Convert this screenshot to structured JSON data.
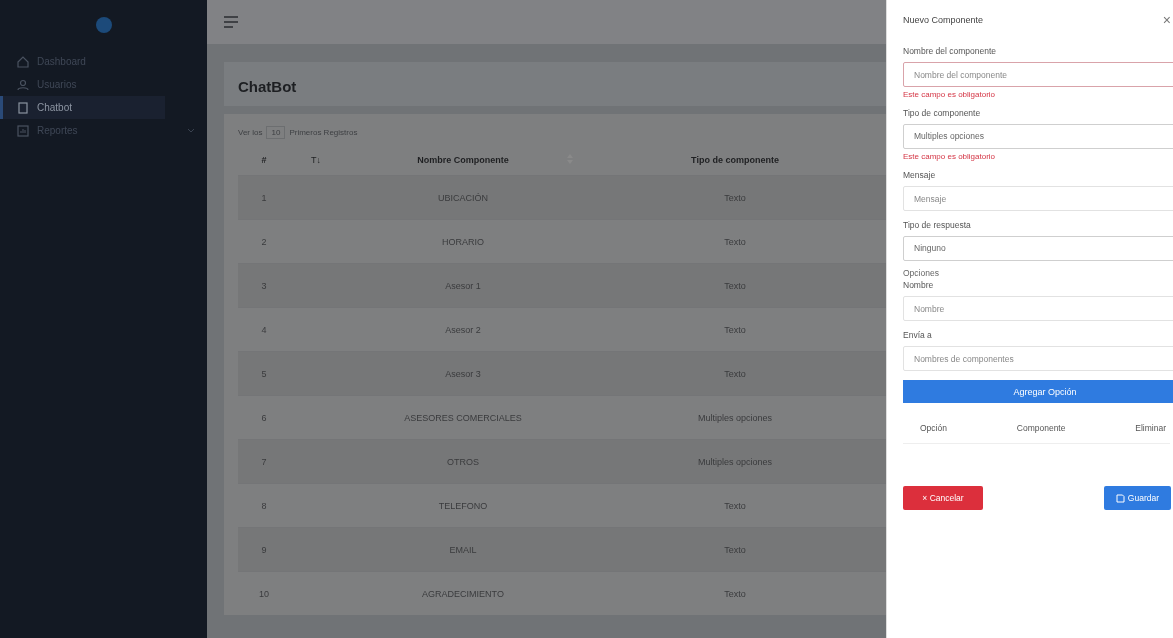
{
  "sidebar": {
    "items": [
      {
        "label": "Dashboard",
        "selected": false,
        "expandable": false
      },
      {
        "label": "Usuarios",
        "selected": false,
        "expandable": false
      },
      {
        "label": "Chatbot",
        "selected": true,
        "expandable": false
      },
      {
        "label": "Reportes",
        "selected": false,
        "expandable": true
      }
    ]
  },
  "page_title": "ChatBot",
  "table": {
    "length_prefix": "Ver los",
    "length_value": "10",
    "length_suffix": "Primeros Registros",
    "columns": [
      {
        "label": "#",
        "sortable": false
      },
      {
        "label": "T↓",
        "sortable": false
      },
      {
        "label": "Nombre Componente",
        "sortable": true
      },
      {
        "label": "Tipo de componente",
        "sortable": false
      }
    ],
    "rows": [
      [
        "1",
        "",
        "UBICACIÓN",
        "Texto"
      ],
      [
        "2",
        "",
        "HORARIO",
        "Texto"
      ],
      [
        "3",
        "",
        "Asesor 1",
        "Texto"
      ],
      [
        "4",
        "",
        "Asesor 2",
        "Texto"
      ],
      [
        "5",
        "",
        "Asesor 3",
        "Texto"
      ],
      [
        "6",
        "",
        "ASESORES COMERCIALES",
        "Multiples opciones"
      ],
      [
        "7",
        "",
        "OTROS",
        "Multiples opciones"
      ],
      [
        "8",
        "",
        "TELEFONO",
        "Texto"
      ],
      [
        "9",
        "",
        "EMAIL",
        "Texto"
      ],
      [
        "10",
        "",
        "AGRADECIMIENTO",
        "Texto"
      ]
    ]
  },
  "drawer": {
    "title": "Nuevo Componente",
    "close": "×",
    "fields": [
      {
        "kind": "input",
        "label": "Nombre del componente",
        "placeholder": "Nombre del componente",
        "invalid": true,
        "error": "Este campo es obligatorio"
      },
      {
        "kind": "select",
        "label": "Tipo de componente",
        "value": "Multiples opciones",
        "invalid": false,
        "error": "Este campo es obligatorio"
      },
      {
        "kind": "input",
        "label": "Mensaje",
        "placeholder": "Mensaje",
        "invalid": false
      },
      {
        "kind": "select",
        "label": "Tipo de respuesta",
        "value": "Ninguno",
        "invalid": false
      },
      {
        "kind": "heading",
        "label": "Opciones"
      },
      {
        "kind": "input",
        "label": "Nombre",
        "placeholder": "Nombre",
        "invalid": false
      },
      {
        "kind": "input",
        "label": "Envía a",
        "placeholder": "Nombres de componentes",
        "invalid": false
      }
    ],
    "add_button": "Agregar Opción",
    "options_columns": [
      "Opción",
      "Componente",
      "Eliminar"
    ],
    "cancel_button": "× Cancelar",
    "save_button": "Guardar"
  }
}
